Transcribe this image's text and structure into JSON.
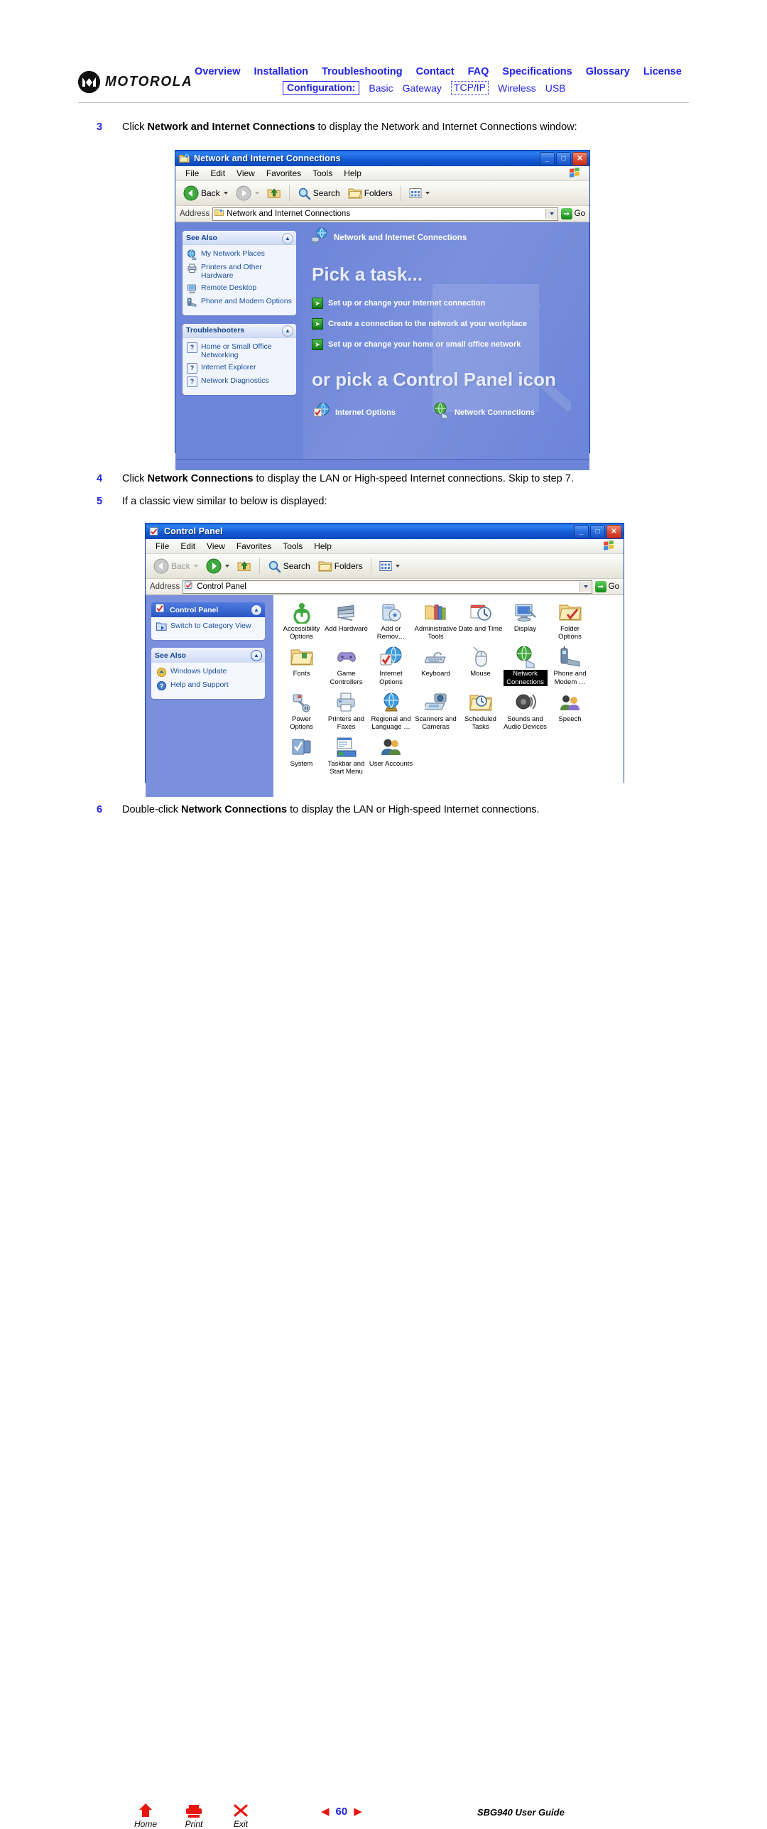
{
  "header": {
    "logo_text": "MOTOROLA",
    "nav_primary": [
      {
        "label": "Overview"
      },
      {
        "label": "Installation"
      },
      {
        "label": "Troubleshooting"
      },
      {
        "label": "Contact"
      },
      {
        "label": "FAQ"
      },
      {
        "label": "Specifications"
      },
      {
        "label": "Glossary"
      },
      {
        "label": "License"
      }
    ],
    "nav_secondary_label": "Configuration:",
    "nav_secondary": [
      {
        "label": "Basic",
        "selected": false
      },
      {
        "label": "Gateway",
        "selected": false
      },
      {
        "label": "TCP/IP",
        "selected": true
      },
      {
        "label": "Wireless",
        "selected": false
      },
      {
        "label": "USB",
        "selected": false
      }
    ],
    "accent_color": "#2222e6"
  },
  "steps": {
    "step3": {
      "num": "3",
      "pre": "Click ",
      "bold": "Network and Internet Connections",
      "post": " to display the Network and Internet Connections window:"
    },
    "step4": {
      "num": "4",
      "pre": "Click ",
      "bold": "Network Connections",
      "post": " to display the LAN or High-speed Internet connections. Skip to step 7."
    },
    "step5": {
      "num": "5",
      "text": "If a classic view similar to below is displayed:"
    },
    "step6": {
      "num": "6",
      "pre": "Double-click ",
      "bold": "Network Connections",
      "post": " to display the LAN or High-speed Internet connections."
    }
  },
  "window1": {
    "title": "Network and Internet Connections",
    "window_icon": "folder-network-icon",
    "titlebar_buttons": [
      {
        "name": "minimize-button",
        "glyph": "_"
      },
      {
        "name": "maximize-button",
        "glyph": "□"
      },
      {
        "name": "close-button",
        "glyph": "✕"
      }
    ],
    "menu": [
      "File",
      "Edit",
      "View",
      "Favorites",
      "Tools",
      "Help"
    ],
    "toolbar": {
      "back": "Back",
      "forward": "",
      "up": "",
      "search": "Search",
      "folders": "Folders",
      "views": ""
    },
    "address": {
      "label": "Address",
      "value": "Network and Internet Connections",
      "go": "Go"
    },
    "sidebar": [
      {
        "title": "See Also",
        "items": [
          {
            "label": "My Network Places",
            "icon": "globe-network-icon"
          },
          {
            "label": "Printers and Other Hardware",
            "icon": "printer-icon"
          },
          {
            "label": "Remote Desktop",
            "icon": "remote-desktop-icon"
          },
          {
            "label": "Phone and Modem Options",
            "icon": "phone-modem-icon"
          }
        ]
      },
      {
        "title": "Troubleshooters",
        "items": [
          {
            "label": "Home or Small Office Networking",
            "icon": "question-icon"
          },
          {
            "label": "Internet Explorer",
            "icon": "question-icon"
          },
          {
            "label": "Network Diagnostics",
            "icon": "question-icon"
          }
        ]
      }
    ],
    "main": {
      "heading_icon_label": "Network and Internet Connections",
      "pick_task_heading": "Pick a task...",
      "tasks": [
        {
          "label": "Set up or change your Internet connection"
        },
        {
          "label": "Create a connection to the network at your workplace"
        },
        {
          "label": "Set up or change your home or small office network"
        }
      ],
      "pick_icon_heading": "or pick a Control Panel icon",
      "cp_icons": [
        {
          "label": "Internet Options",
          "icon": "internet-options-icon"
        },
        {
          "label": "Network Connections",
          "icon": "network-connections-icon"
        }
      ]
    }
  },
  "window2": {
    "title": "Control Panel",
    "window_icon": "control-panel-icon",
    "titlebar_buttons": [
      {
        "name": "minimize-button",
        "glyph": "_"
      },
      {
        "name": "maximize-button",
        "glyph": "□"
      },
      {
        "name": "close-button",
        "glyph": "✕"
      }
    ],
    "menu": [
      "File",
      "Edit",
      "View",
      "Favorites",
      "Tools",
      "Help"
    ],
    "toolbar": {
      "back": "Back",
      "search": "Search",
      "folders": "Folders"
    },
    "address": {
      "label": "Address",
      "value": "Control Panel",
      "go": "Go"
    },
    "sidebar": [
      {
        "title": "Control Panel",
        "style": "dark",
        "icon": "control-panel-icon",
        "items": [
          {
            "label": "Switch to Category View",
            "icon": "category-view-icon"
          }
        ]
      },
      {
        "title": "See Also",
        "style": "light",
        "items": [
          {
            "label": "Windows Update",
            "icon": "windows-update-icon"
          },
          {
            "label": "Help and Support",
            "icon": "help-support-icon"
          }
        ]
      }
    ],
    "icons": [
      {
        "label": "Accessibility Options",
        "icon": "accessibility-icon",
        "selected": false
      },
      {
        "label": "Add Hardware",
        "icon": "add-hardware-icon",
        "selected": false
      },
      {
        "label": "Add or Remov…",
        "icon": "add-remove-programs-icon",
        "selected": false
      },
      {
        "label": "Administrative Tools",
        "icon": "administrative-tools-icon",
        "selected": false
      },
      {
        "label": "Date and Time",
        "icon": "date-time-icon",
        "selected": false
      },
      {
        "label": "Display",
        "icon": "display-icon",
        "selected": false
      },
      {
        "label": "Folder Options",
        "icon": "folder-options-icon",
        "selected": false
      },
      {
        "label": "Fonts",
        "icon": "fonts-icon",
        "selected": false
      },
      {
        "label": "Game Controllers",
        "icon": "game-controllers-icon",
        "selected": false
      },
      {
        "label": "Internet Options",
        "icon": "internet-options-icon",
        "selected": false
      },
      {
        "label": "Keyboard",
        "icon": "keyboard-icon",
        "selected": false
      },
      {
        "label": "Mouse",
        "icon": "mouse-icon",
        "selected": false
      },
      {
        "label": "Network Connections",
        "icon": "network-connections-icon",
        "selected": true
      },
      {
        "label": "Phone and Modem …",
        "icon": "phone-modem-icon",
        "selected": false
      },
      {
        "label": "Power Options",
        "icon": "power-options-icon",
        "selected": false
      },
      {
        "label": "Printers and Faxes",
        "icon": "printers-faxes-icon",
        "selected": false
      },
      {
        "label": "Regional and Language …",
        "icon": "regional-language-icon",
        "selected": false
      },
      {
        "label": "Scanners and Cameras",
        "icon": "scanners-cameras-icon",
        "selected": false
      },
      {
        "label": "Scheduled Tasks",
        "icon": "scheduled-tasks-icon",
        "selected": false
      },
      {
        "label": "Sounds and Audio Devices",
        "icon": "sounds-audio-icon",
        "selected": false
      },
      {
        "label": "Speech",
        "icon": "speech-icon",
        "selected": false
      },
      {
        "label": "System",
        "icon": "system-icon",
        "selected": false
      },
      {
        "label": "Taskbar and Start Menu",
        "icon": "taskbar-start-menu-icon",
        "selected": false
      },
      {
        "label": "User Accounts",
        "icon": "user-accounts-icon",
        "selected": false
      }
    ]
  },
  "footer": {
    "buttons": [
      {
        "label": "Home",
        "icon": "home-icon"
      },
      {
        "label": "Print",
        "icon": "print-icon"
      },
      {
        "label": "Exit",
        "icon": "exit-icon"
      }
    ],
    "prev_arrow": "◀",
    "page_number": "60",
    "next_arrow": "▶",
    "guide_text": "SBG940 User Guide",
    "accent_color": "#e8150f"
  }
}
